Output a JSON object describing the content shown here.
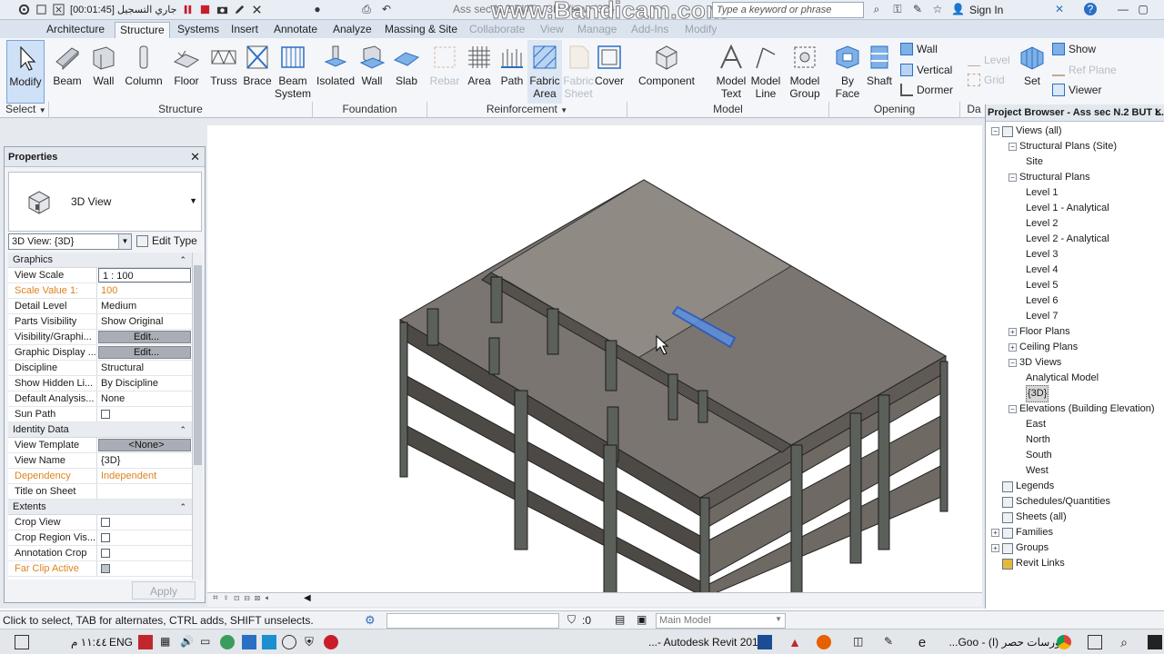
{
  "title_bar": {
    "recording_label": "جاري التسجيل [00:01:45]",
    "window_title": "Ass sec N.2 BUT... 3D View: {3D}",
    "watermark": "www.Bandicam.com",
    "search_placeholder": "Type a keyword or phrase",
    "sign_in": "Sign In"
  },
  "tabs": [
    "Architecture",
    "Structure",
    "Systems",
    "Insert",
    "Annotate",
    "Analyze",
    "Massing & Site",
    "Collaborate",
    "View",
    "Manage",
    "Add-Ins",
    "Modify"
  ],
  "active_tab": "Structure",
  "ribbon": {
    "modify": "Modify",
    "select": "Select",
    "structure_tools": [
      "Beam",
      "Wall",
      "Column",
      "Floor",
      "Truss",
      "Brace",
      "Beam System"
    ],
    "foundation_tools": [
      "Isolated",
      "Wall",
      "Slab"
    ],
    "reinforcement_tools": [
      "Rebar",
      "Area",
      "Path",
      "Fabric Area",
      "Fabric Sheet",
      "Cover"
    ],
    "model_tools": [
      "Component",
      "Model Text",
      "Model Line",
      "Model Group"
    ],
    "opening_tools": [
      "By Face",
      "Shaft"
    ],
    "opening_small": [
      "Wall",
      "Vertical",
      "Dormer"
    ],
    "datum_small": [
      "Level",
      "Grid"
    ],
    "workplane": {
      "set": "Set",
      "show": "Show",
      "ref_plane": "Ref Plane",
      "viewer": "Viewer"
    },
    "panels": {
      "select": "Select",
      "structure": "Structure",
      "foundation": "Foundation",
      "reinforcement": "Reinforcement",
      "model": "Model",
      "opening": "Opening",
      "datum": "Da"
    }
  },
  "properties": {
    "title": "Properties",
    "type_name": "3D View",
    "instance_selector": "3D View: {3D}",
    "edit_type": "Edit Type",
    "apply": "Apply",
    "sections": {
      "graphics": "Graphics",
      "identity": "Identity Data",
      "extents": "Extents"
    },
    "graphics_rows": [
      {
        "k": "View Scale",
        "v": "1 : 100"
      },
      {
        "k": "Scale Value    1:",
        "v": "100"
      },
      {
        "k": "Detail Level",
        "v": "Medium"
      },
      {
        "k": "Parts Visibility",
        "v": "Show Original"
      },
      {
        "k": "Visibility/Graphi...",
        "v": "Edit..."
      },
      {
        "k": "Graphic Display ...",
        "v": "Edit..."
      },
      {
        "k": "Discipline",
        "v": "Structural"
      },
      {
        "k": "Show Hidden Li...",
        "v": "By Discipline"
      },
      {
        "k": "Default Analysis...",
        "v": "None"
      },
      {
        "k": "Sun Path",
        "v": ""
      }
    ],
    "identity_rows": [
      {
        "k": "View Template",
        "v": "<None>"
      },
      {
        "k": "View Name",
        "v": "{3D}"
      },
      {
        "k": "Dependency",
        "v": "Independent"
      },
      {
        "k": "Title on Sheet",
        "v": ""
      }
    ],
    "extents_rows": [
      {
        "k": "Crop View",
        "v": ""
      },
      {
        "k": "Crop Region Vis...",
        "v": ""
      },
      {
        "k": "Annotation Crop",
        "v": ""
      },
      {
        "k": "Far Clip Active",
        "v": ""
      }
    ]
  },
  "project_browser": {
    "title": "Project Browser - Ass sec N.2 BUT L...",
    "nodes": [
      {
        "label": "Views (all)"
      },
      {
        "label": "Structural Plans (Site)"
      },
      {
        "label": "Site"
      },
      {
        "label": "Structural Plans"
      },
      {
        "label": "Level 1"
      },
      {
        "label": "Level 1 - Analytical"
      },
      {
        "label": "Level 2"
      },
      {
        "label": "Level 2 - Analytical"
      },
      {
        "label": "Level 3"
      },
      {
        "label": "Level 4"
      },
      {
        "label": "Level 5"
      },
      {
        "label": "Level 6"
      },
      {
        "label": "Level 7"
      },
      {
        "label": "Floor Plans"
      },
      {
        "label": "Ceiling Plans"
      },
      {
        "label": "3D Views"
      },
      {
        "label": "Analytical Model"
      },
      {
        "label": "{3D}"
      },
      {
        "label": "Elevations (Building Elevation)"
      },
      {
        "label": "East"
      },
      {
        "label": "North"
      },
      {
        "label": "South"
      },
      {
        "label": "West"
      },
      {
        "label": "Legends"
      },
      {
        "label": "Schedules/Quantities"
      },
      {
        "label": "Sheets (all)"
      },
      {
        "label": "Families"
      },
      {
        "label": "Groups"
      },
      {
        "label": "Revit Links"
      }
    ]
  },
  "status": {
    "message": "Click to select, TAB for alternates, CTRL adds, SHIFT unselects.",
    "filter_count": ":0",
    "model": "Main Model"
  },
  "taskbar": {
    "time": "١١:٤٤ م",
    "lang": "ENG",
    "revit_app": "...- Autodesk Revit 2015",
    "chrome_tab": "كورسات حصر (I) - Goo..."
  },
  "colors": {
    "accent": "#2a6fc4",
    "orange": "#e0821e",
    "slab": "#7b7571",
    "column": "#5c605a"
  }
}
